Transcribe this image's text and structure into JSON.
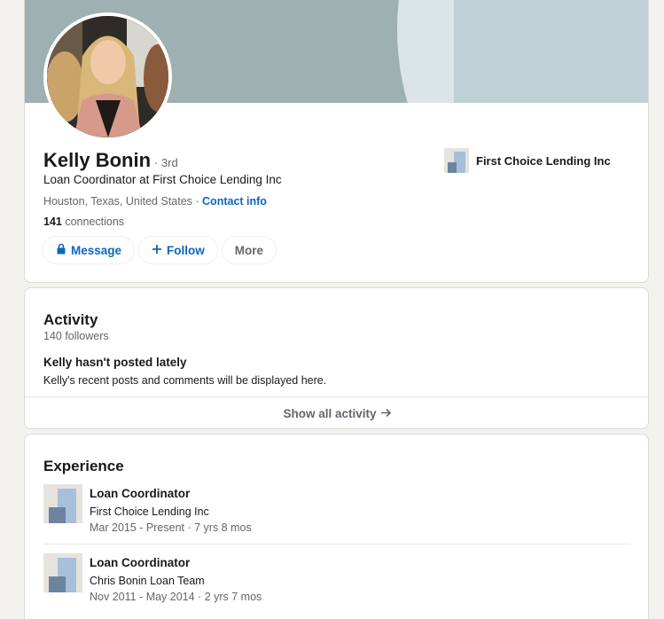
{
  "profile": {
    "name": "Kelly Bonin",
    "degree": "· 3rd",
    "headline": "Loan Coordinator at First Choice Lending Inc",
    "location": "Houston, Texas, United States",
    "location_separator": " · ",
    "contact_info_label": "Contact info",
    "connections_count": "141",
    "connections_label": " connections",
    "current_company": "First Choice Lending Inc"
  },
  "actions": {
    "message_label": "Message",
    "follow_label": "Follow",
    "more_label": "More"
  },
  "activity": {
    "title": "Activity",
    "followers": "140 followers",
    "empty_title": "Kelly hasn't posted lately",
    "empty_description": "Kelly's recent posts and comments will be displayed here.",
    "show_all_label": "Show all activity"
  },
  "experience": {
    "title": "Experience",
    "items": [
      {
        "title": "Loan Coordinator",
        "company": "First Choice Lending Inc",
        "dates": "Mar 2015 - Present · 7 yrs 8 mos"
      },
      {
        "title": "Loan Coordinator",
        "company": "Chris Bonin Loan Team",
        "dates": "Nov 2011 - May 2014 · 2 yrs 7 mos"
      }
    ]
  },
  "colors": {
    "link_blue": "#0a66c2",
    "page_bg": "#f3f2ef",
    "banner_gray": "#9fb0b3",
    "muted_text": "#666666"
  },
  "icons": {
    "message": "lock-icon",
    "follow": "plus-icon",
    "show_all": "arrow-right-icon",
    "company_logo": "building-logo-icon"
  }
}
